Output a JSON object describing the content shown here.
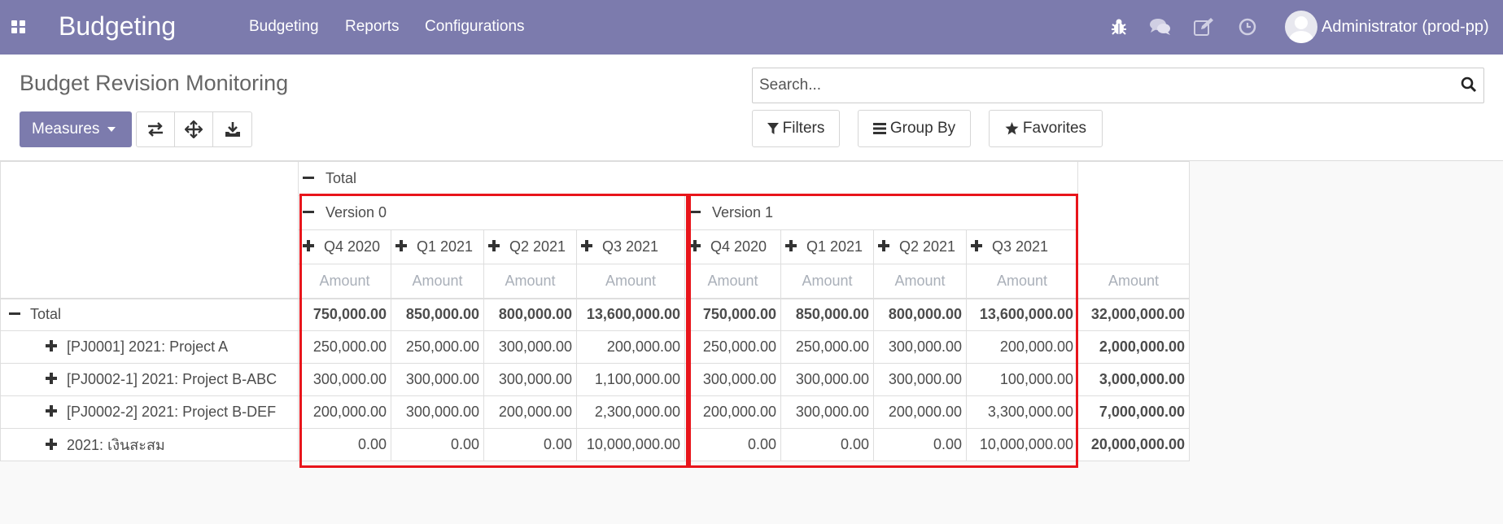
{
  "navbar": {
    "app_title": "Budgeting",
    "menus": [
      "Budgeting",
      "Reports",
      "Configurations"
    ],
    "system_icons": [
      "bug-icon",
      "chat-icon",
      "edit-icon",
      "clock-icon"
    ],
    "user": "Administrator (prod-pp)",
    "bg_color": "#7c7bad"
  },
  "control_panel": {
    "page_title": "Budget Revision Monitoring",
    "measures_label": "Measures",
    "tools": [
      "flip-axis-icon",
      "expand-all-icon",
      "download-icon"
    ],
    "search_placeholder": "Search...",
    "filters_label": "Filters",
    "group_by_label": "Group By",
    "favorites_label": "Favorites"
  },
  "pivot": {
    "total_header": "Total",
    "versions": [
      {
        "label": "Version 0",
        "periods": [
          "Q4 2020",
          "Q1 2021",
          "Q2 2021",
          "Q3 2021"
        ]
      },
      {
        "label": "Version 1",
        "periods": [
          "Q4 2020",
          "Q1 2021",
          "Q2 2021",
          "Q3 2021"
        ]
      }
    ],
    "measure": "Amount",
    "rows": [
      {
        "label": "Total",
        "level": 0,
        "expanded": true,
        "values": [
          "750,000.00",
          "850,000.00",
          "800,000.00",
          "13,600,000.00",
          "750,000.00",
          "850,000.00",
          "800,000.00",
          "13,600,000.00"
        ],
        "total": "32,000,000.00"
      },
      {
        "label": "[PJ0001] 2021: Project A",
        "level": 1,
        "expanded": false,
        "values": [
          "250,000.00",
          "250,000.00",
          "300,000.00",
          "200,000.00",
          "250,000.00",
          "250,000.00",
          "300,000.00",
          "200,000.00"
        ],
        "total": "2,000,000.00"
      },
      {
        "label": "[PJ0002-1] 2021: Project B-ABC",
        "level": 1,
        "expanded": false,
        "values": [
          "300,000.00",
          "300,000.00",
          "300,000.00",
          "1,100,000.00",
          "300,000.00",
          "300,000.00",
          "300,000.00",
          "100,000.00"
        ],
        "total": "3,000,000.00"
      },
      {
        "label": "[PJ0002-2] 2021: Project B-DEF",
        "level": 1,
        "expanded": false,
        "values": [
          "200,000.00",
          "300,000.00",
          "200,000.00",
          "2,300,000.00",
          "200,000.00",
          "300,000.00",
          "200,000.00",
          "3,300,000.00"
        ],
        "total": "7,000,000.00"
      },
      {
        "label": "2021: เงินสะสม",
        "level": 1,
        "expanded": false,
        "values": [
          "0.00",
          "0.00",
          "0.00",
          "10,000,000.00",
          "0.00",
          "0.00",
          "0.00",
          "10,000,000.00"
        ],
        "total": "20,000,000.00"
      }
    ],
    "highlight_color": "#e8151b"
  }
}
